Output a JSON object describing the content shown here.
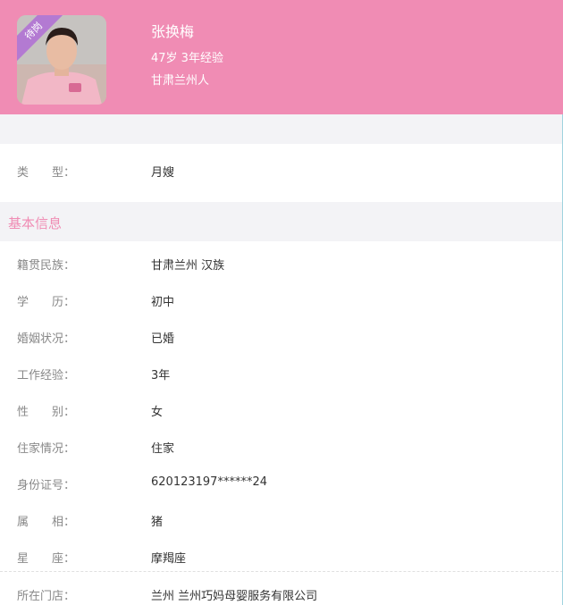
{
  "profile": {
    "name": "张换梅",
    "age_experience": "47岁 3年经验",
    "origin": "甘肃兰州人",
    "status_badge": "待岗"
  },
  "type_row": {
    "label": "类型：",
    "value": "月嫂"
  },
  "section": {
    "title": "基本信息"
  },
  "info": {
    "native_ethnicity": {
      "label": "籍贯民族：",
      "value": "甘肃兰州 汉族"
    },
    "education": {
      "label": "学历：",
      "value": "初中"
    },
    "marital": {
      "label": "婚姻状况：",
      "value": "已婚"
    },
    "experience": {
      "label": "工作经验：",
      "value": "3年"
    },
    "gender": {
      "label": "性别：",
      "value": "女"
    },
    "residence": {
      "label": "住家情况：",
      "value": "住家"
    },
    "id_number": {
      "label": "身份证号：",
      "value": "620123197******24"
    },
    "zodiac": {
      "label": "属相：",
      "value": "猪"
    },
    "constellation": {
      "label": "星座：",
      "value": "摩羯座"
    },
    "store": {
      "label": "所在门店：",
      "value": "兰州 兰州巧妈母婴服务有限公司"
    }
  },
  "colors": {
    "header_bg": "#f08cb4",
    "accent": "#f08cb4",
    "badge": "#b37ad2",
    "section_bg": "#f3f3f6"
  }
}
